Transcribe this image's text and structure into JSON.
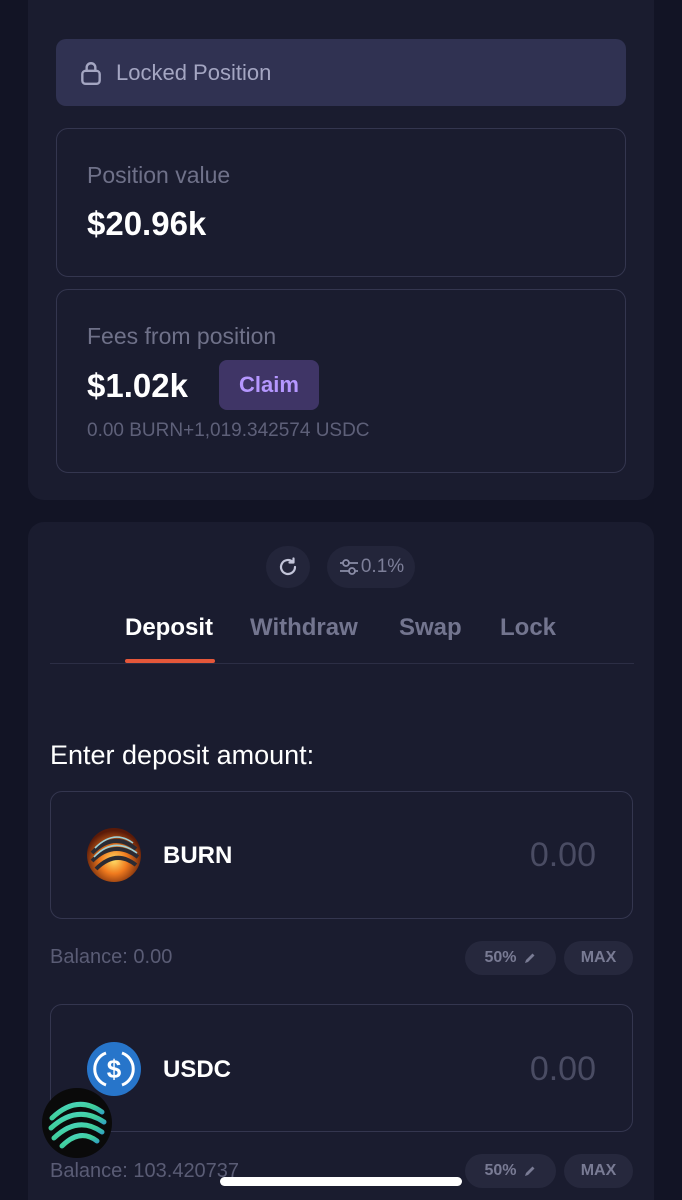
{
  "locked": {
    "label": "Locked Position"
  },
  "position": {
    "label": "Position value",
    "value": "$20.96k"
  },
  "fees": {
    "label": "Fees from position",
    "value": "$1.02k",
    "claim_label": "Claim",
    "breakdown": "0.00 BURN+1,019.342574 USDC"
  },
  "controls": {
    "slippage": "0.1%"
  },
  "tabs": [
    {
      "label": "Deposit",
      "active": true
    },
    {
      "label": "Withdraw",
      "active": false
    },
    {
      "label": "Swap",
      "active": false
    },
    {
      "label": "Lock",
      "active": false
    }
  ],
  "deposit": {
    "prompt": "Enter deposit amount:",
    "tokens": [
      {
        "symbol": "BURN",
        "amount": "0.00",
        "balance": "Balance: 0.00",
        "pct_label": "50%",
        "max_label": "MAX"
      },
      {
        "symbol": "USDC",
        "amount": "0.00",
        "balance": "Balance: 103.420737",
        "pct_label": "50%",
        "max_label": "MAX"
      }
    ]
  },
  "colors": {
    "accent": "#e5573a",
    "claim_text": "#b597ff",
    "usdc_blue": "#2775ca"
  }
}
